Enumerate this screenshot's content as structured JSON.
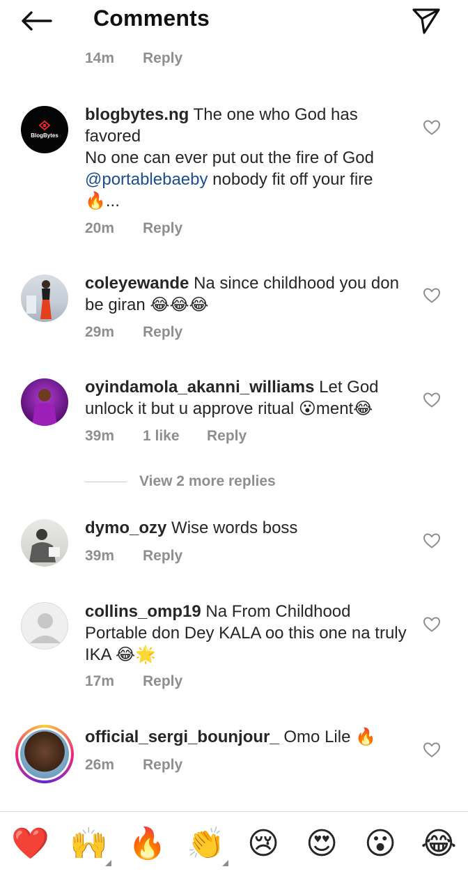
{
  "header": {
    "title": "Comments",
    "back_icon": "arrow-left-icon",
    "share_icon": "send-icon"
  },
  "partial_previous": {
    "time": "14m",
    "reply_label": "Reply"
  },
  "comments": [
    {
      "username": "blogbytes.ng",
      "avatar_text": "BlogBytes",
      "text_line1": " The one who God has favored",
      "text_line2": "No one can ever put out the fire of God",
      "mention": "@portablebaeby",
      "text_line3": " nobody fit off your fire",
      "text_line4": "🔥...",
      "time": "20m",
      "reply_label": "Reply"
    },
    {
      "username": "coleyewande",
      "text": " Na since childhood you don be giran 😂😂😂",
      "time": "29m",
      "reply_label": "Reply"
    },
    {
      "username": "oyindamola_akanni_williams",
      "text": " Let God unlock it but u approve ritual 😮ment😂",
      "time": "39m",
      "likes": "1 like",
      "reply_label": "Reply"
    },
    {
      "username": "dymo_ozy",
      "text": " Wise words boss",
      "time": "39m",
      "reply_label": "Reply"
    },
    {
      "username": "collins_omp19",
      "text": " Na From Childhood Portable  don Dey KALA oo this one na truly IKA 😂🌟",
      "time": "17m",
      "reply_label": "Reply"
    },
    {
      "username": "official_sergi_bounjour_",
      "text": " Omo Lile 🔥",
      "time": "26m",
      "reply_label": "Reply"
    }
  ],
  "view_more_replies": "View 2 more replies",
  "emoji_bar": [
    "❤️",
    "🙌",
    "🔥",
    "👏",
    "😢",
    "😍",
    "😮",
    "😂"
  ],
  "colors": {
    "muted_text": "#8e8e8e",
    "mention": "#1a4e8f",
    "heart_outline": "#8e8e8e"
  }
}
